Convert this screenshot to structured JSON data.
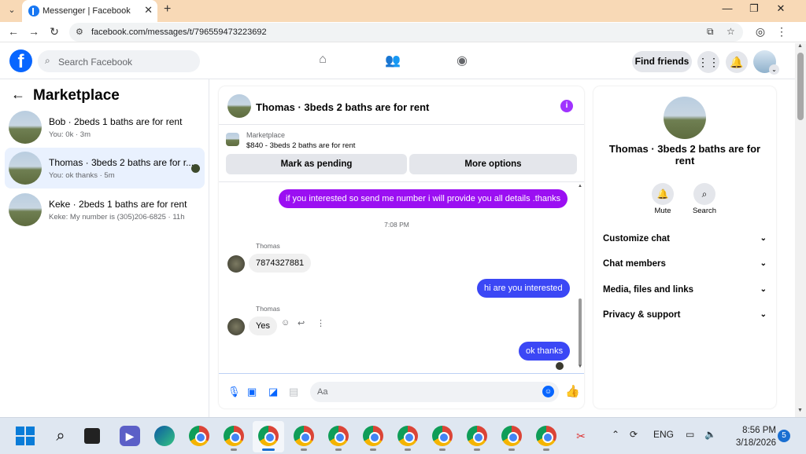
{
  "browser": {
    "tab_title": "Messenger | Facebook",
    "url": "facebook.com/messages/t/796559473223692"
  },
  "header": {
    "search_placeholder": "Search Facebook",
    "find_friends": "Find friends"
  },
  "left": {
    "title": "Marketplace",
    "conversations": [
      {
        "name": "Bob · 2beds 1 baths are for rent",
        "preview": "You: 0k · 3m"
      },
      {
        "name": "Thomas · 3beds 2 baths are for r...",
        "preview": "You: ok thanks · 5m"
      },
      {
        "name": "Keke · 2beds 1 baths are for rent",
        "preview": "Keke: My number is (305)206-6825 · 11h"
      }
    ]
  },
  "chat": {
    "title": "Thomas · 3beds 2 baths are for rent",
    "marketplace_label": "Marketplace",
    "listing": "$840 - 3beds 2 baths are for rent",
    "mark_pending": "Mark as pending",
    "more_options": "More options",
    "messages": [
      {
        "text": "if you interested so send me number i will provide you all details .thanks"
      },
      {
        "text": "7:08 PM"
      },
      {
        "sender": "Thomas",
        "text": "7874327881"
      },
      {
        "text": "hi are you interested"
      },
      {
        "sender": "Thomas",
        "text": "Yes"
      },
      {
        "text": "ok thanks"
      }
    ],
    "composer_placeholder": "Aa"
  },
  "right": {
    "name": "Thomas · 3beds 2 baths are for rent",
    "mute": "Mute",
    "search": "Search",
    "sections": [
      "Customize chat",
      "Chat members",
      "Media, files and links",
      "Privacy & support"
    ]
  },
  "taskbar": {
    "lang": "ENG",
    "time": "8:56 PM",
    "date": "3/18/2026",
    "notifications": "5"
  },
  "colors": {
    "fb_blue": "#0866ff",
    "purple_bubble": "#9b0ff2",
    "blue_bubble": "#3b47f5",
    "tab_strip": "#f8d9b6"
  }
}
